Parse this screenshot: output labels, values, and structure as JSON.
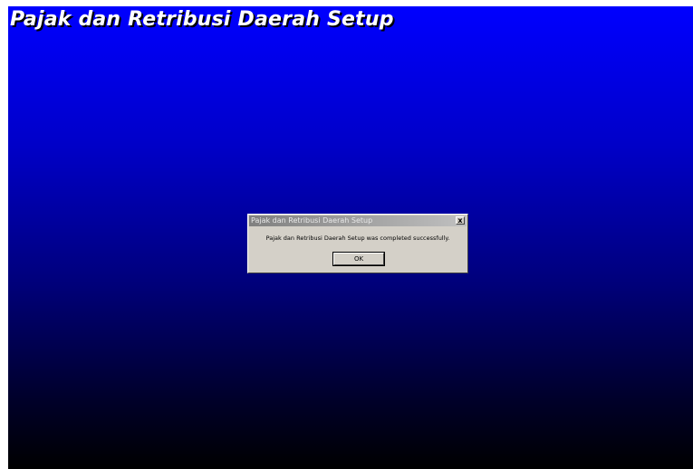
{
  "screen": {
    "title": "Pajak dan Retribusi Daerah Setup",
    "background_top": "#0000ff",
    "background_bottom": "#000000"
  },
  "dialog": {
    "title": "Pajak dan Retribusi Daerah Setup",
    "close_label": "x",
    "message": "Pajak dan Retribusi Daerah Setup was completed successfully.",
    "ok_label": "OK",
    "icon": "close-icon"
  }
}
